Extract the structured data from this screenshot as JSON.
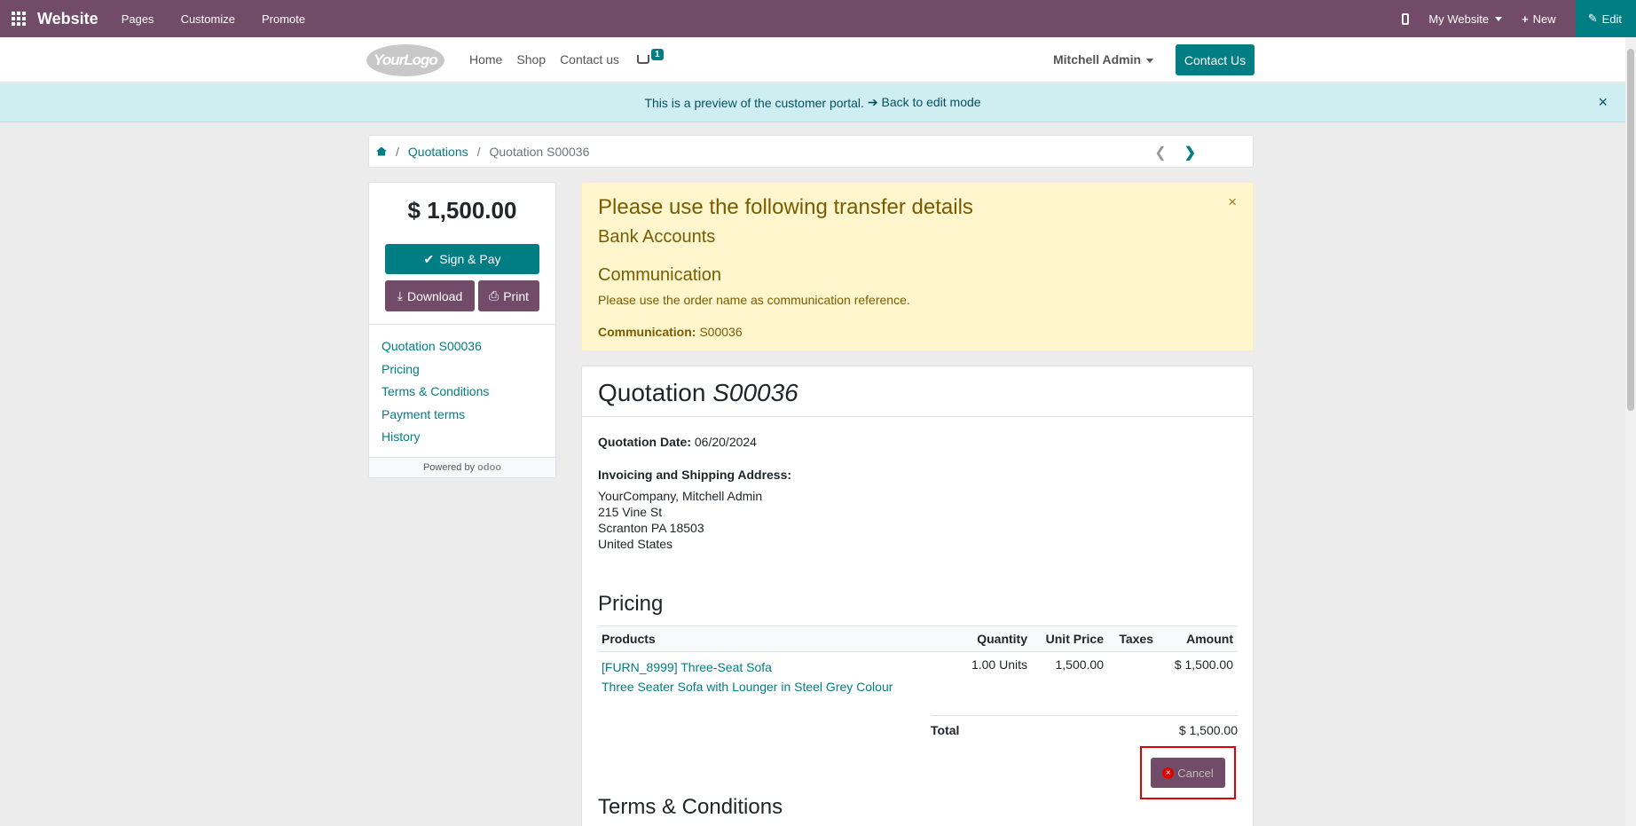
{
  "adminbar": {
    "brand": "Website",
    "menus": [
      "Pages",
      "Customize",
      "Promote"
    ],
    "website_label": "My Website",
    "new_label": "New",
    "edit_label": "Edit"
  },
  "header": {
    "logo_text": "YourLogo",
    "nav": [
      "Home",
      "Shop",
      "Contact us"
    ],
    "cart_count": "1",
    "user": "Mitchell Admin",
    "contact_button": "Contact Us"
  },
  "banner": {
    "text": "This is a preview of the customer portal.",
    "link": "Back to edit mode",
    "close": "×"
  },
  "breadcrumb": {
    "items": [
      "Quotations",
      "Quotation S00036"
    ]
  },
  "sidebar": {
    "amount": "$ 1,500.00",
    "sign_pay": "Sign & Pay",
    "download": "Download",
    "print": "Print",
    "links": [
      "Quotation S00036",
      "Pricing",
      "Terms & Conditions",
      "Payment terms",
      "History"
    ],
    "powered_by": "Powered by",
    "odoo": "odoo"
  },
  "alert": {
    "title": "Please use the following transfer details",
    "bank_accounts": "Bank Accounts",
    "communication_heading": "Communication",
    "communication_text": "Please use the order name as communication reference.",
    "communication_label": "Communication:",
    "communication_value": "S00036",
    "close": "×"
  },
  "quotation": {
    "title_prefix": "Quotation",
    "title_ref": "S00036",
    "date_label": "Quotation Date:",
    "date_value": "06/20/2024",
    "address_label": "Invoicing and Shipping Address:",
    "address_lines": [
      "YourCompany, Mitchell Admin",
      "215 Vine St",
      "Scranton PA 18503",
      "United States"
    ],
    "pricing_heading": "Pricing",
    "columns": [
      "Products",
      "Quantity",
      "Unit Price",
      "Taxes",
      "Amount"
    ],
    "lines": [
      {
        "product": "[FURN_8999] Three-Seat Sofa",
        "description": "Three Seater Sofa with Lounger in Steel Grey Colour",
        "quantity": "1.00 Units",
        "unit_price": "1,500.00",
        "taxes": "",
        "amount": "$ 1,500.00"
      }
    ],
    "total_label": "Total",
    "total_value": "$ 1,500.00",
    "cancel_label": "Cancel",
    "terms_heading": "Terms & Conditions"
  },
  "colors": {
    "brand": "#714b67",
    "accent": "#017e84",
    "highlight": "#e00000"
  }
}
